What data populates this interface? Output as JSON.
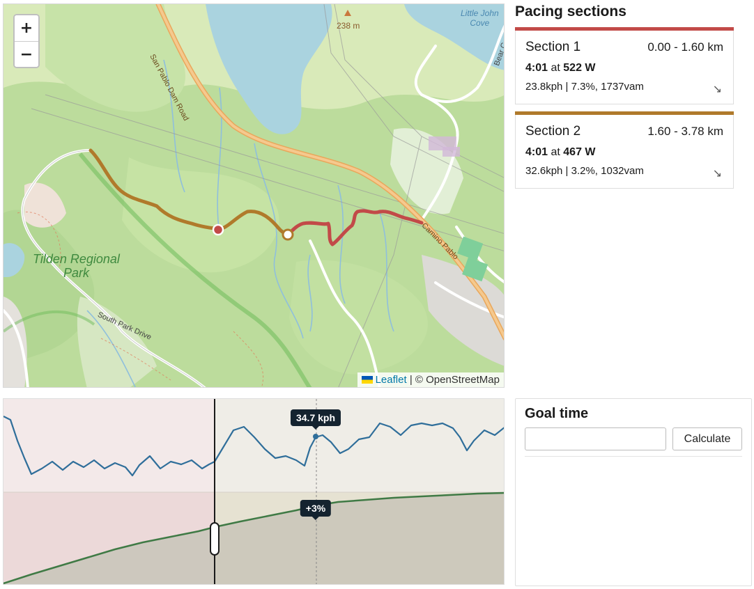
{
  "map": {
    "zoom_in_label": "+",
    "zoom_out_label": "−",
    "elevation_label": "238 m",
    "place_labels": {
      "little_john_cove": [
        "Little John",
        "Cove"
      ],
      "tilden_park": [
        "Tilden Regional",
        "Park"
      ],
      "san_pablo_dam_road": "San Pablo Dam Road",
      "camino_pablo": "Camino Pablo",
      "south_park_drive": "South Park Drive",
      "bear": "Bear C"
    },
    "attribution": {
      "leaflet": "Leaflet",
      "osm": "| © OpenStreetMap"
    },
    "colors": {
      "section1": "#c24a48",
      "section2": "#b07a2b",
      "water": "#aad3df",
      "forest": "#a8d08a",
      "road_major": "#f2bf79"
    }
  },
  "sidebar": {
    "title": "Pacing sections",
    "sections": [
      {
        "name": "Section 1",
        "range": "0.00 - 1.60 km",
        "time": "4:01",
        "at": "at",
        "power": "522 W",
        "stats": "23.8kph | 7.3%, 1737vam",
        "color": "#c24a48"
      },
      {
        "name": "Section 2",
        "range": "1.60 - 3.78 km",
        "time": "4:01",
        "at": "at",
        "power": "467 W",
        "stats": "32.6kph | 3.2%, 1032vam",
        "color": "#b07a2b"
      }
    ],
    "expand_icon": "↘"
  },
  "profile": {
    "speed_tooltip": "34.7 kph",
    "grade_tooltip": "+3%"
  },
  "goal": {
    "title": "Goal time",
    "input_value": "",
    "input_placeholder": "",
    "button_label": "Calculate"
  }
}
